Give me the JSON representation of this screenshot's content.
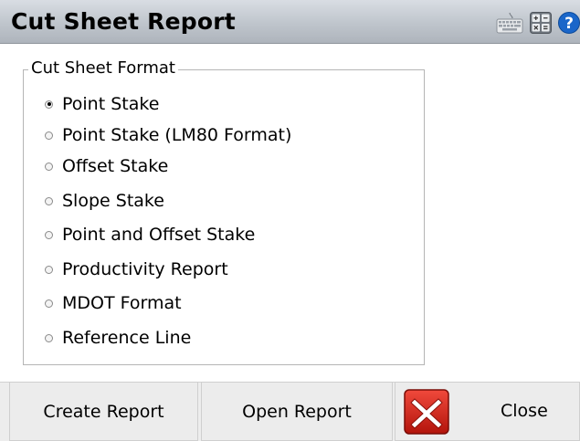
{
  "title": "Cut Sheet Report",
  "toolbar_icons": [
    "keyboard-icon",
    "calculator-icon",
    "help-icon"
  ],
  "group": {
    "title": "Cut Sheet Format",
    "options": [
      {
        "label": "Point Stake",
        "selected": true
      },
      {
        "label": "Point Stake (LM80 Format)",
        "selected": false
      },
      {
        "label": "Offset Stake",
        "selected": false
      },
      {
        "label": "Slope Stake",
        "selected": false
      },
      {
        "label": "Point and Offset Stake",
        "selected": false
      },
      {
        "label": "Productivity Report",
        "selected": false
      },
      {
        "label": "MDOT Format",
        "selected": false
      },
      {
        "label": "Reference Line",
        "selected": false
      }
    ]
  },
  "buttons": {
    "create": "Create Report",
    "open": "Open Report",
    "close": "Close"
  },
  "colors": {
    "titlebar": "#c3c8cf",
    "close_icon_red": "#d9261c",
    "help_blue": "#1a66c9"
  }
}
